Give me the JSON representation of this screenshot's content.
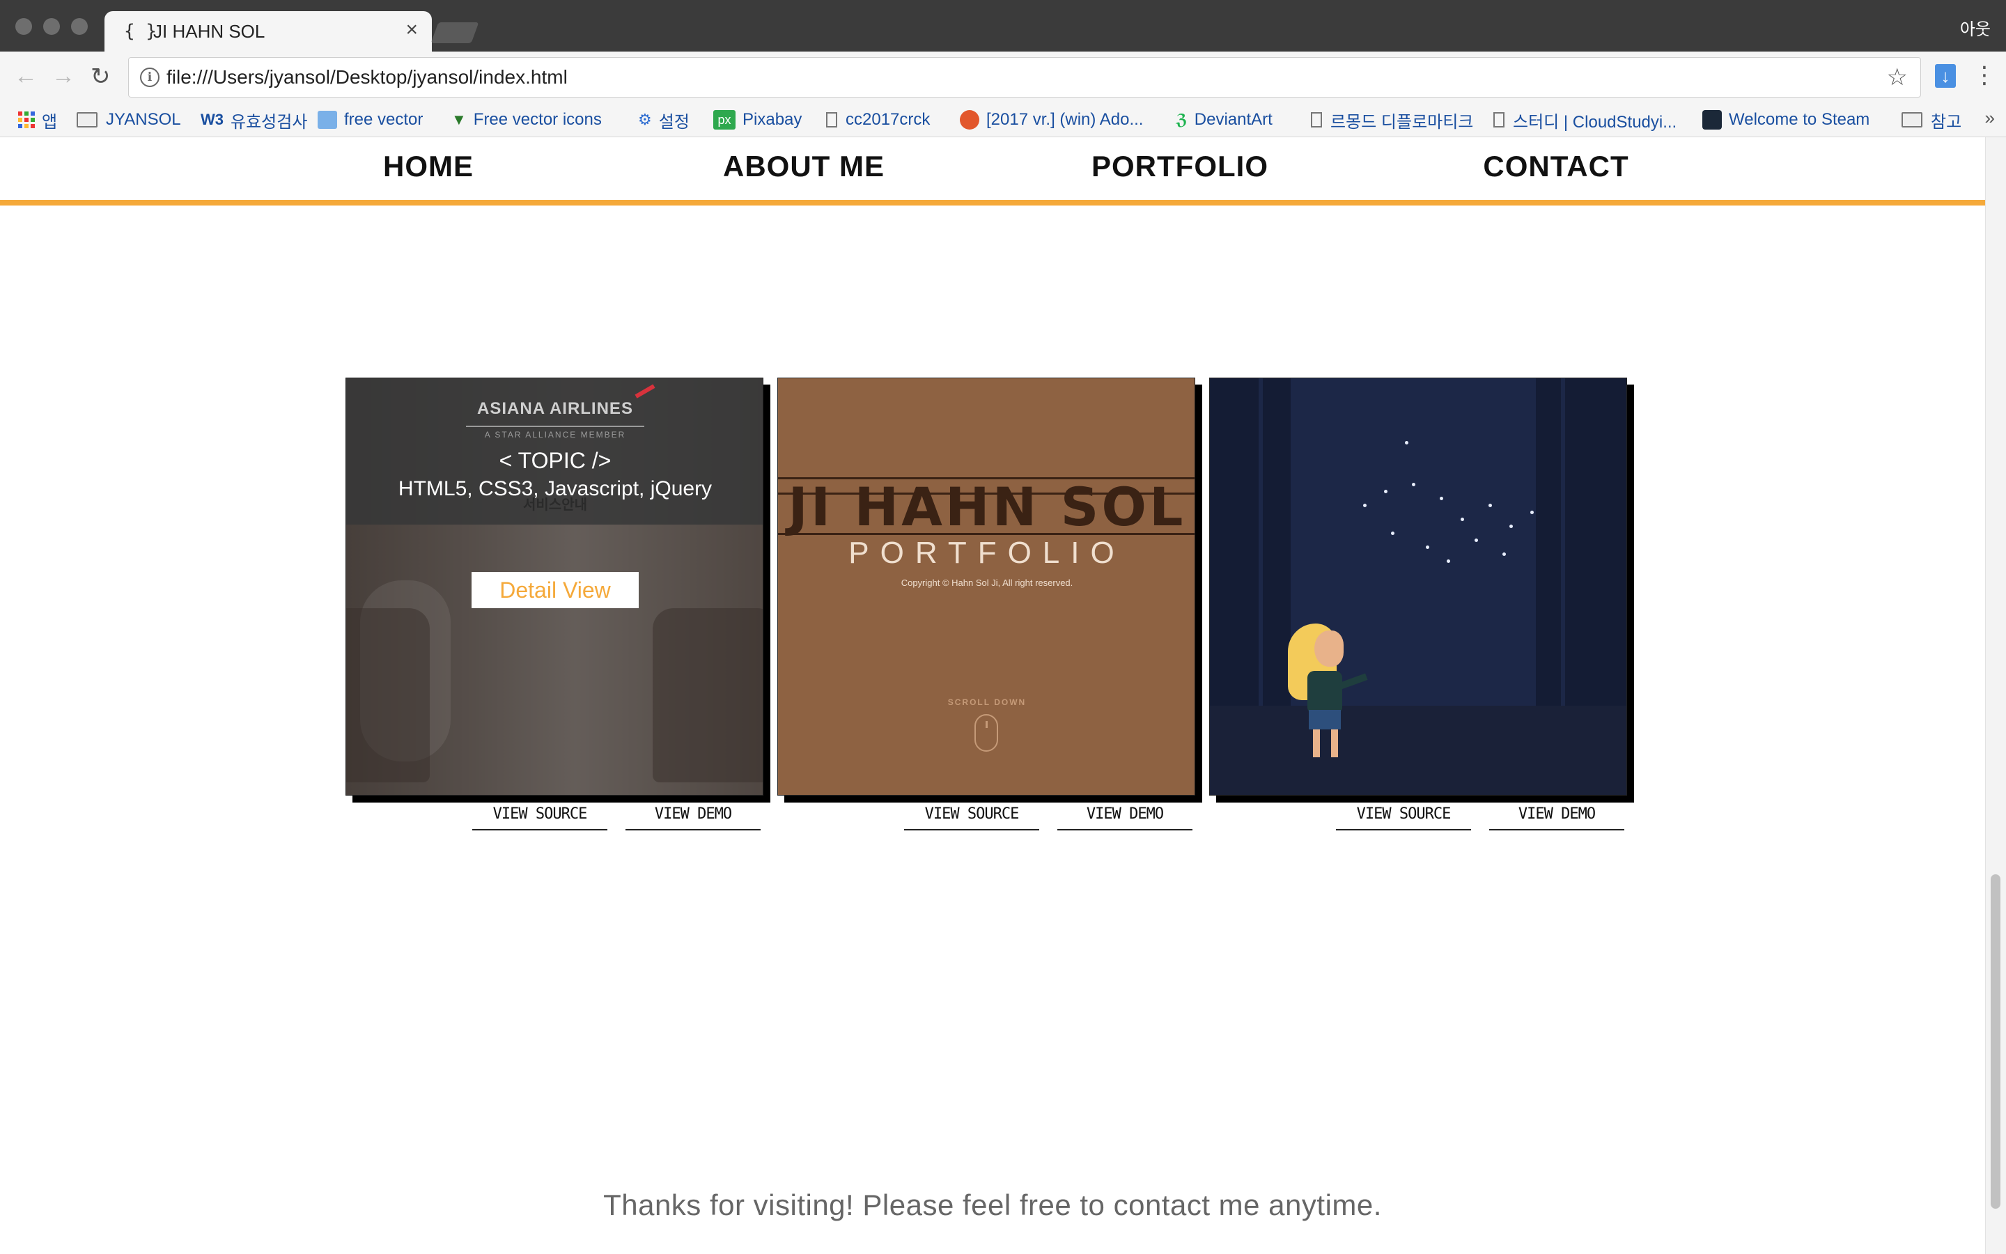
{
  "browser": {
    "tab_title": "JI HAHN SOL",
    "tab_favicon": "{ }",
    "profile_name": "아웃",
    "url": "file:///Users/jyansol/Desktop/jyansol/index.html",
    "bookmarks": [
      {
        "label": "앱",
        "icon": "apps-grid-icon"
      },
      {
        "label": "JYANSOL",
        "icon": "folder-icon"
      },
      {
        "label": "유효성검사",
        "icon": "w3-icon"
      },
      {
        "label": "free vector",
        "icon": "image-icon"
      },
      {
        "label": "Free vector icons",
        "icon": "vector-icon"
      },
      {
        "label": "설정",
        "icon": "gear-icon"
      },
      {
        "label": "Pixabay",
        "icon": "pixabay-icon"
      },
      {
        "label": "cc2017crck",
        "icon": "document-icon"
      },
      {
        "label": "[2017 vr.] (win) Ado...",
        "icon": "site-icon"
      },
      {
        "label": "DeviantArt",
        "icon": "deviantart-icon"
      },
      {
        "label": "르몽드 디플로마티크",
        "icon": "document-icon"
      },
      {
        "label": "스터디 | CloudStudyi...",
        "icon": "document-icon"
      },
      {
        "label": "Welcome to Steam",
        "icon": "steam-icon"
      },
      {
        "label": "참고",
        "icon": "folder-icon"
      }
    ],
    "bookmarks_overflow": "»",
    "w3_label": "W3",
    "pixabay_label": "px"
  },
  "nav": {
    "items": [
      "HOME",
      "ABOUT ME",
      "PORTFOLIO",
      "CONTACT"
    ]
  },
  "portfolio": {
    "card1": {
      "logo": "ASIANA AIRLINES",
      "logo_sub": "A STAR ALLIANCE MEMBER",
      "logo_korean": "서비스안내",
      "topic": "< TOPIC />",
      "tech": "HTML5, CSS3, Javascript, jQuery",
      "detail_button": "Detail View"
    },
    "card2": {
      "title": "JI HAHN SOL",
      "subtitle": "PORTFOLIO",
      "copyright": "Copyright © Hahn Sol Ji, All right reserved.",
      "scroll_hint": "SCROLL DOWN"
    },
    "links": [
      {
        "source": "VIEW SOURCE",
        "demo": "VIEW DEMO"
      },
      {
        "source": "VIEW SOURCE",
        "demo": "VIEW DEMO"
      },
      {
        "source": "VIEW SOURCE",
        "demo": "VIEW DEMO"
      }
    ]
  },
  "footer": {
    "message": "Thanks for visiting! Please feel free to contact me anytime."
  },
  "colors": {
    "accent": "#f5a93a",
    "titlebar": "#3b3b3b",
    "bookmark_text": "#1a4fa0"
  }
}
